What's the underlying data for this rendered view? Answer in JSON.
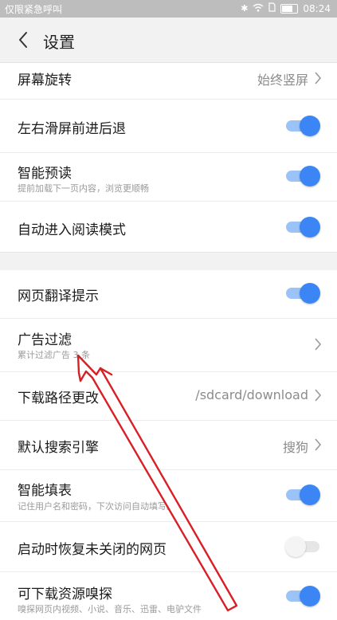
{
  "status_bar": {
    "carrier_text": "仅限紧急呼叫",
    "time": "08:24",
    "battery_percent": 67
  },
  "header": {
    "title": "设置"
  },
  "settings": {
    "screen_rotation": {
      "label": "屏幕旋转",
      "value": "始终竖屏"
    },
    "swipe_nav": {
      "label": "左右滑屏前进后退",
      "enabled": true
    },
    "smart_preload": {
      "label": "智能预读",
      "sub": "提前加载下一页内容，浏览更顺畅",
      "enabled": true
    },
    "auto_read_mode": {
      "label": "自动进入阅读模式",
      "enabled": true
    },
    "translate_hint": {
      "label": "网页翻译提示",
      "enabled": true
    },
    "ad_filter": {
      "label": "广告过滤",
      "sub": "累计过滤广告 3 条"
    },
    "download_path": {
      "label": "下载路径更改",
      "value": "/sdcard/download"
    },
    "search_engine": {
      "label": "默认搜索引擎",
      "value": "搜狗"
    },
    "smart_fill": {
      "label": "智能填表",
      "sub": "记住用户名和密码，下次访问自动填写。",
      "enabled": true
    },
    "restore_pages": {
      "label": "启动时恢复未关闭的网页",
      "enabled": false
    },
    "resource_sniff": {
      "label": "可下载资源嗅探",
      "sub": "嗅探网页内视频、小说、音乐、迅雷、电驴文件",
      "enabled": true
    }
  },
  "colors": {
    "accent": "#3b86f4",
    "annotation": "#d91f26"
  }
}
